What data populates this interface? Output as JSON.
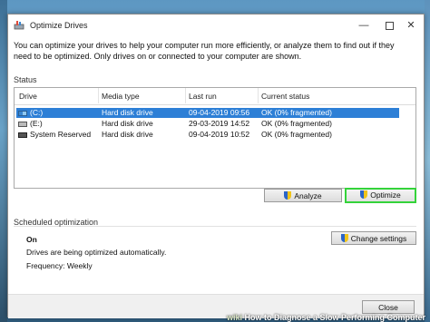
{
  "window": {
    "title": "Optimize Drives",
    "description": "You can optimize your drives to help your computer run more efficiently, or analyze them to find out if they need to be optimized. Only drives on or connected to your computer are shown."
  },
  "status": {
    "label": "Status",
    "columns": [
      "Drive",
      "Media type",
      "Last run",
      "Current status"
    ],
    "rows": [
      {
        "drive": "(C:)",
        "media": "Hard disk drive",
        "last_run": "09-04-2019 09:56",
        "status": "OK (0% fragmented)",
        "selected": true,
        "icon": "windows-drive-icon"
      },
      {
        "drive": "(E:)",
        "media": "Hard disk drive",
        "last_run": "29-03-2019 14:52",
        "status": "OK (0% fragmented)",
        "selected": false,
        "icon": "drive-icon"
      },
      {
        "drive": "System Reserved",
        "media": "Hard disk drive",
        "last_run": "09-04-2019 10:52",
        "status": "OK (0% fragmented)",
        "selected": false,
        "icon": "drive-icon"
      }
    ]
  },
  "buttons": {
    "analyze": "Analyze",
    "optimize": "Optimize",
    "change_settings": "Change settings",
    "close": "Close"
  },
  "scheduled": {
    "label": "Scheduled optimization",
    "state": "On",
    "info": "Drives are being optimized automatically.",
    "frequency": "Frequency: Weekly"
  },
  "watermark": {
    "brand": "wiki",
    "text": "How to Diagnose a Slow Performing Computer"
  },
  "colors": {
    "selection": "#2d7fd6",
    "highlight_border": "#34d33a"
  }
}
